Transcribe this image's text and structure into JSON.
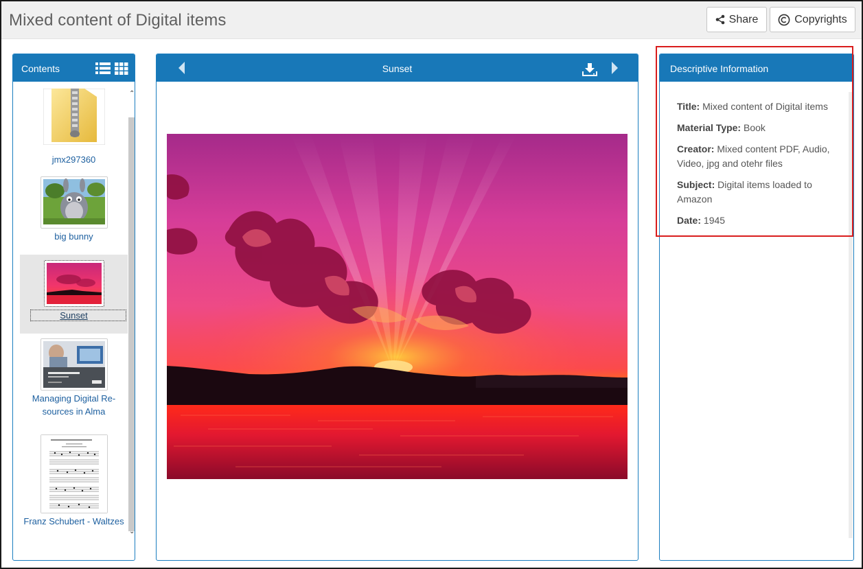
{
  "header": {
    "title": "Mixed content of Digital items",
    "share_label": "Share",
    "copyrights_label": "Copyrights"
  },
  "contents": {
    "title": "Contents",
    "items": [
      {
        "label": "jmx297360",
        "icon": "zip-folder-icon",
        "selected": false
      },
      {
        "label": "big bunny",
        "icon": "video-thumbnail",
        "selected": false
      },
      {
        "label": "Sunset",
        "icon": "image-thumbnail",
        "selected": true
      },
      {
        "label": "Managing Digital Re-",
        "label2": "sources in Alma",
        "icon": "presentation-thumbnail",
        "selected": false
      },
      {
        "label": "Franz Schubert - Waltzes",
        "icon": "sheet-music-thumbnail",
        "selected": false
      }
    ]
  },
  "viewer": {
    "title": "Sunset"
  },
  "description": {
    "title": "Descriptive Information",
    "fields": [
      {
        "label": "Title:",
        "value": "Mixed content of Digital items"
      },
      {
        "label": "Material Type:",
        "value": "Book"
      },
      {
        "label": "Creator:",
        "value": "Mixed content PDF, Audio, Video, jpg and otehr files"
      },
      {
        "label": "Subject:",
        "value": "Digital items loaded to Amazon"
      },
      {
        "label": "Date:",
        "value": "1945"
      }
    ]
  },
  "colors": {
    "accent": "#1878b8",
    "link": "#1c5f9f",
    "highlight": "#d91c1c"
  }
}
